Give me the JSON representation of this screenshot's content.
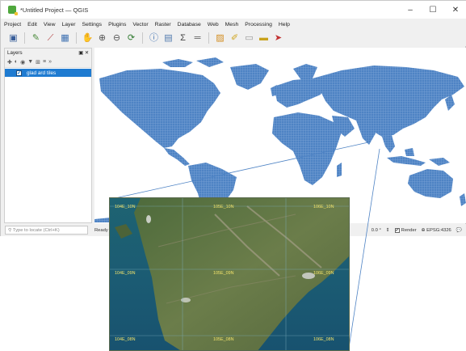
{
  "window": {
    "title": "*Untitled Project — QGIS",
    "controls": {
      "minimize": "–",
      "maximize": "☐",
      "close": "✕"
    }
  },
  "menu": [
    "Project",
    "Edit",
    "View",
    "Layer",
    "Settings",
    "Plugins",
    "Vector",
    "Raster",
    "Database",
    "Web",
    "Mesh",
    "Processing",
    "Help"
  ],
  "toolbar_icons": [
    "save-icon",
    "digitize-icon",
    "measure-icon",
    "layers-icon",
    "pan-icon",
    "zoom-in-icon",
    "zoom-out-icon",
    "refresh-icon",
    "identify-icon",
    "table-icon",
    "sum-icon",
    "measure-line-icon",
    "select-icon",
    "edit-icon",
    "filter-icon",
    "label-icon",
    "pointer-icon"
  ],
  "layers_panel": {
    "title": "Layers",
    "header_buttons": "▣ ✕",
    "layers": [
      {
        "name": "glad ard tiles",
        "checked": true
      }
    ]
  },
  "statusbar": {
    "locator_placeholder": "Type to locate (Ctrl+K)",
    "ready": "Ready",
    "rotation": "0.0 °",
    "render_label": "Render",
    "crs": "EPSG:4326"
  },
  "inset": {
    "tiles": [
      {
        "label": "104E_10N"
      },
      {
        "label": "105E_10N"
      },
      {
        "label": "106E_10N"
      },
      {
        "label": "104E_09N"
      },
      {
        "label": "105E_09N"
      },
      {
        "label": "106E_09N"
      },
      {
        "label": "104E_08N"
      },
      {
        "label": "105E_08N"
      },
      {
        "label": "106E_08N"
      }
    ]
  },
  "colors": {
    "land_tiles": "#4e83c4",
    "selection": "#1f7bd1",
    "tile_label": "#f2e36b"
  }
}
